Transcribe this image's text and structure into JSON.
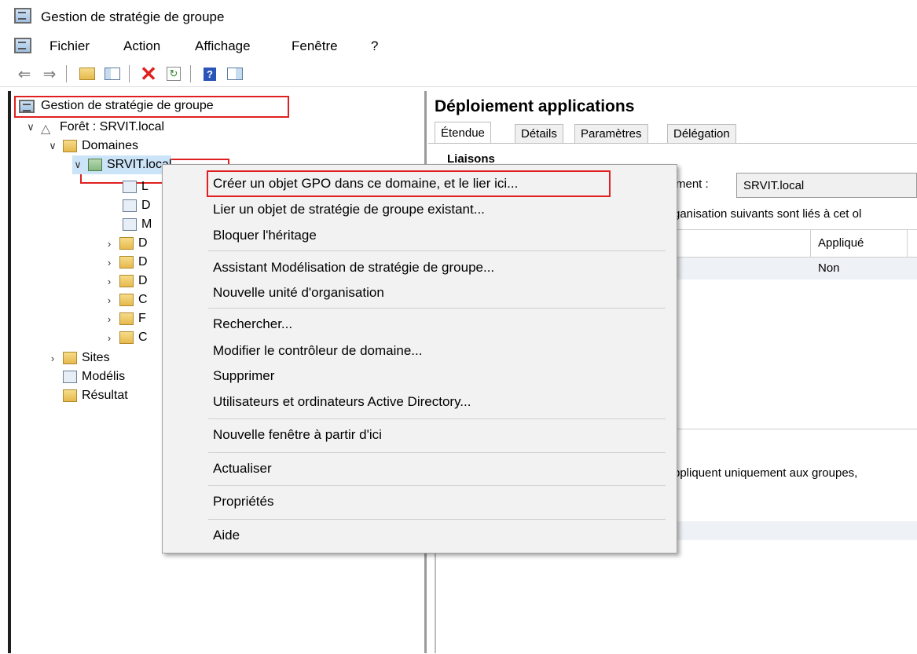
{
  "window": {
    "title": "Gestion de stratégie de groupe"
  },
  "menubar": {
    "items": [
      "Fichier",
      "Action",
      "Affichage",
      "Fenêtre",
      "?"
    ]
  },
  "toolbar": {
    "buttons": [
      "back-arrow-icon",
      "forward-arrow-icon",
      "up-folder-icon",
      "show-hide-tree-icon",
      "delete-icon",
      "refresh-icon",
      "help-icon",
      "console-tree-icon"
    ],
    "delete_color": "#e0201e"
  },
  "tree": {
    "root": "Gestion de stratégie de groupe",
    "forest": "Forêt : SRVIT.local",
    "domains": "Domaines",
    "domain": "SRVIT.local",
    "children_initials": [
      "L",
      "D",
      "M",
      "D",
      "D",
      "D",
      "C",
      "F",
      "C"
    ],
    "sites": "Sites",
    "modeling": "Modélis",
    "results": "Résultat"
  },
  "rightpane": {
    "title": "Déploiement applications",
    "tabs": [
      "Étendue",
      "Détails",
      "Paramètres",
      "Délégation"
    ],
    "links_heading": "Liaisons",
    "domain_label": "ment :",
    "domain_value": "SRVIT.local",
    "links_text": "ganisation suivants sont liés à cet ol",
    "col_applied": "Appliqué",
    "row_applied": "Non",
    "filter_text": "ppliquent uniquement aux groupes,"
  },
  "context_menu": {
    "items": [
      "Créer un objet GPO dans ce domaine, et le lier ici...",
      "Lier un objet de stratégie de groupe existant...",
      "Bloquer l'héritage",
      "Assistant Modélisation de stratégie de groupe...",
      "Nouvelle unité d'organisation",
      "Rechercher...",
      "Modifier le contrôleur de domaine...",
      "Supprimer",
      "Utilisateurs et ordinateurs Active Directory...",
      "Nouvelle fenêtre à partir d'ici",
      "Actualiser",
      "Propriétés",
      "Aide"
    ]
  },
  "colors": {
    "highlight_box": "#e02020"
  }
}
